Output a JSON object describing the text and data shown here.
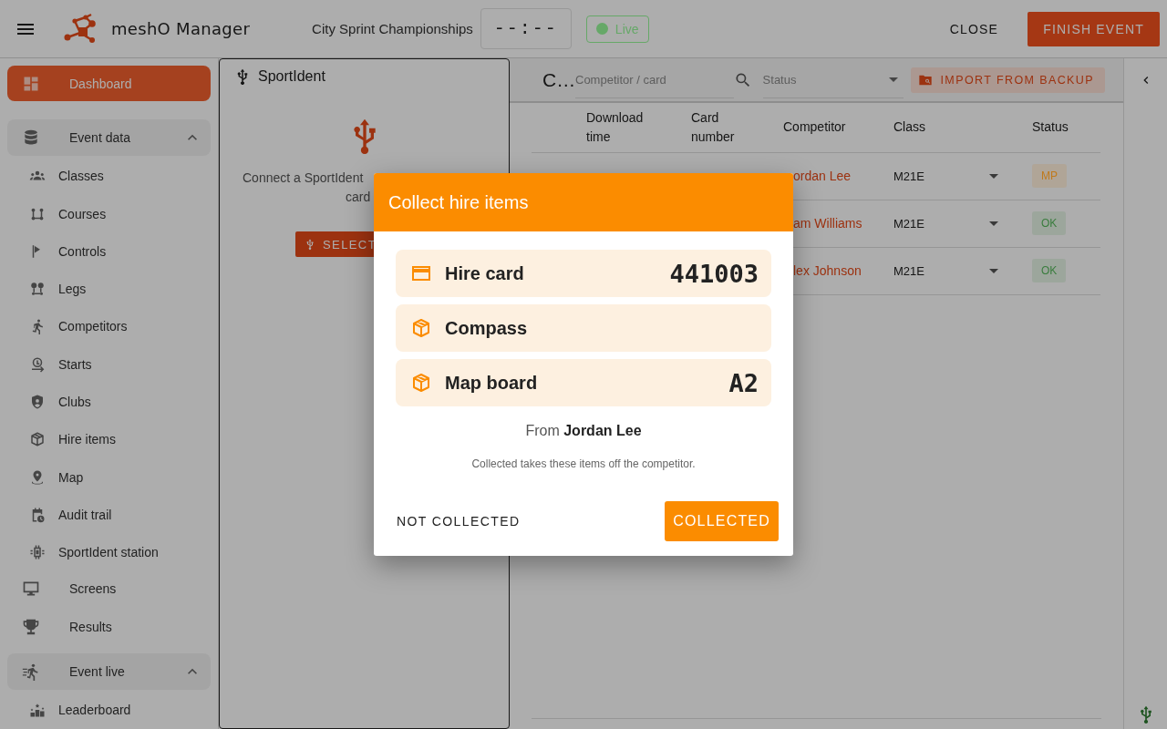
{
  "app_bar": {
    "title": "meshO Manager",
    "event_name": "City Sprint Championships",
    "clock": "--:--",
    "live_status": {
      "label": "Live",
      "color": "#66a868"
    },
    "actions": [
      {
        "label": "CLOSE",
        "kind": "text"
      },
      {
        "label": "FINISH EVENT",
        "kind": "filled"
      }
    ]
  },
  "sidebar": {
    "items": [
      {
        "label": "Dashboard",
        "kind": "link",
        "selected": true
      },
      {
        "label": "Event data",
        "kind": "group",
        "expanded": true,
        "children": [
          {
            "label": "Classes",
            "selected": false
          },
          {
            "label": "Courses",
            "selected": false
          },
          {
            "label": "Controls",
            "selected": false
          },
          {
            "label": "Legs",
            "selected": false
          },
          {
            "label": "Competitors",
            "selected": false
          },
          {
            "label": "Starts",
            "selected": false
          },
          {
            "label": "Clubs",
            "selected": false
          },
          {
            "label": "Hire items",
            "selected": false
          },
          {
            "label": "Map",
            "selected": false
          },
          {
            "label": "Audit trail",
            "selected": false
          },
          {
            "label": "SportIdent station",
            "selected": false
          }
        ]
      },
      {
        "label": "Screens",
        "kind": "link",
        "selected": false
      },
      {
        "label": "Results",
        "kind": "link",
        "selected": false
      },
      {
        "label": "Event live",
        "kind": "group",
        "expanded": true,
        "children": [
          {
            "label": "Leaderboard",
            "selected": false
          }
        ]
      }
    ]
  },
  "reader_panel": {
    "title": "SportIdent",
    "message_lines": [
      "Connect a SportIdent",
      "card"
    ],
    "button": "SELECT"
  },
  "downloads": {
    "title": "C…",
    "search": {
      "placeholder": "Competitor / card"
    },
    "status_filter": {
      "placeholder": "Status"
    },
    "import_button": "IMPORT FROM BACKUP",
    "table": {
      "columns": [
        "Download time",
        "Card number",
        "Competitor",
        "Class",
        "",
        "Status"
      ],
      "rows": [
        {
          "competitor": "ordan Lee",
          "class": "M21E",
          "status": {
            "label": "MP",
            "color": "#c07a1c"
          }
        },
        {
          "competitor": "am Williams",
          "class": "M21E",
          "status": {
            "label": "OK",
            "color": "#3a7d3e"
          }
        },
        {
          "competitor": "lex Johnson",
          "class": "M21E",
          "status": {
            "label": "OK",
            "color": "#3a7d3e"
          }
        }
      ]
    }
  },
  "dialog": {
    "title": "Collect hire items",
    "items": [
      {
        "kind": "card",
        "label": "Hire card",
        "value": "441003"
      },
      {
        "kind": "package",
        "label": "Compass"
      },
      {
        "kind": "package",
        "label": "Map board",
        "value": "A2"
      }
    ],
    "from": "From **Jordan Lee**",
    "note": "Collected takes these items off the competitor.",
    "buttons": [
      {
        "label": "NOT COLLECTED",
        "kind": "text"
      },
      {
        "label": "COLLECTED",
        "kind": "filled"
      }
    ]
  }
}
